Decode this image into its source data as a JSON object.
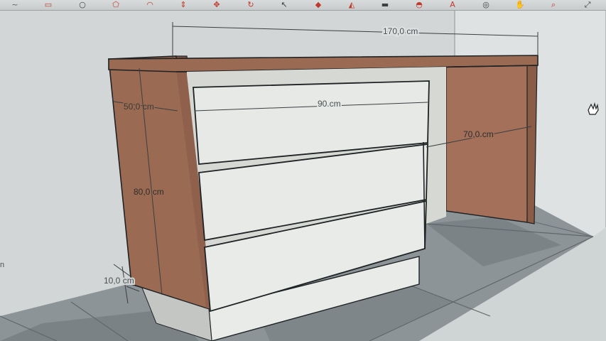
{
  "toolbar": {
    "tools": [
      {
        "icon": "scribble-icon",
        "color": "#5b5f63"
      },
      {
        "icon": "rectangle-icon",
        "color": "#c0392b"
      },
      {
        "icon": "circle-icon",
        "color": "#3b3f42"
      },
      {
        "icon": "polygon-icon",
        "color": "#c0392b"
      },
      {
        "icon": "arc-icon",
        "color": "#c0392b"
      },
      {
        "icon": "push-pull-icon",
        "color": "#c0392b"
      },
      {
        "icon": "move-icon",
        "color": "#c0392b"
      },
      {
        "icon": "rotate-icon",
        "color": "#c0392b"
      },
      {
        "icon": "select-arrow-icon",
        "color": "#3b3f42"
      },
      {
        "icon": "eraser-icon",
        "color": "#c0392b"
      },
      {
        "icon": "paint-bucket-icon",
        "color": "#c0392b"
      },
      {
        "icon": "tape-measure-icon",
        "color": "#3b3f42"
      },
      {
        "icon": "protractor-icon",
        "color": "#c0392b"
      },
      {
        "icon": "text-icon",
        "color": "#c0392b"
      },
      {
        "icon": "orbit-icon",
        "color": "#3b3f42"
      },
      {
        "icon": "pan-icon",
        "color": "#3b3f42"
      },
      {
        "icon": "zoom-icon",
        "color": "#c0392b"
      },
      {
        "icon": "zoom-extents-icon",
        "color": "#3b3f42"
      }
    ]
  },
  "dimensions": {
    "width": "170,0 cm",
    "depth": "50,0 cm",
    "drawer_width": "90 cm",
    "leg_depth": "70,0 cm",
    "height": "80,0 cm",
    "plinth": "10,0 cm"
  },
  "edge_label": "n",
  "colors": {
    "wood": "#9a6a52",
    "wood_dark": "#7e5441",
    "wood_light": "#b07a5e",
    "drawer": "#e6e9e6",
    "floor": "#8a9296",
    "wall": "#d4d8d8",
    "edge": "#1e2224"
  }
}
